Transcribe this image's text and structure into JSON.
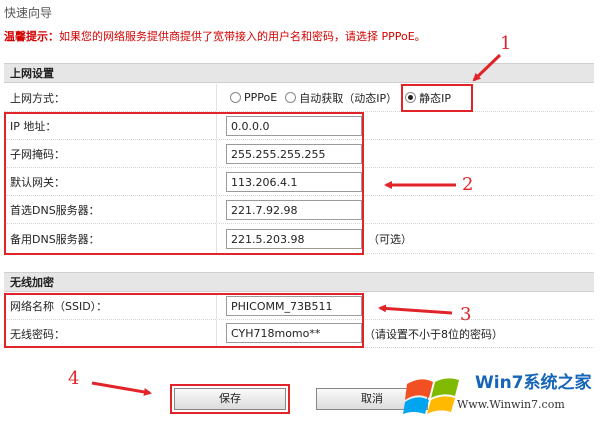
{
  "page": {
    "title": "快速向导",
    "tip_label": "温馨提示：",
    "tip_text": "如果您的网络服务提供商提供了宽带接入的用户名和密码，请选择 PPPoE。"
  },
  "internet": {
    "section_title": "上网设置",
    "mode_label": "上网方式：",
    "options": [
      "PPPoE",
      "自动获取（动态IP）",
      "静态IP"
    ],
    "selected_option": "静态IP",
    "fields": [
      {
        "label": "IP 地址：",
        "value": "0.0.0.0"
      },
      {
        "label": "子网掩码：",
        "value": "255.255.255.255"
      },
      {
        "label": "默认网关：",
        "value": "113.206.4.1"
      },
      {
        "label": "首选DNS服务器：",
        "value": "221.7.92.98"
      },
      {
        "label": "备用DNS服务器：",
        "value": "221.5.203.98",
        "suffix": "（可选）"
      }
    ]
  },
  "wireless": {
    "section_title": "无线加密",
    "ssid_label": "网络名称（SSID）：",
    "ssid_value": "PHICOMM_73B511",
    "password_label": "无线密码：",
    "password_value": "CYH718momo**",
    "password_hint": "（请设置不小于8位的密码）"
  },
  "buttons": {
    "save": "保存",
    "cancel": "取消"
  },
  "annotations": [
    "1",
    "2",
    "3",
    "4"
  ],
  "watermark": {
    "text": "Win7系统之家",
    "url": "Www.Winwin7.com"
  },
  "colors": {
    "annotation_red": "#e0242a",
    "tip_red": "#d40000",
    "section_bg": "#e6e6e6",
    "watermark_blue": "#1565b8"
  }
}
